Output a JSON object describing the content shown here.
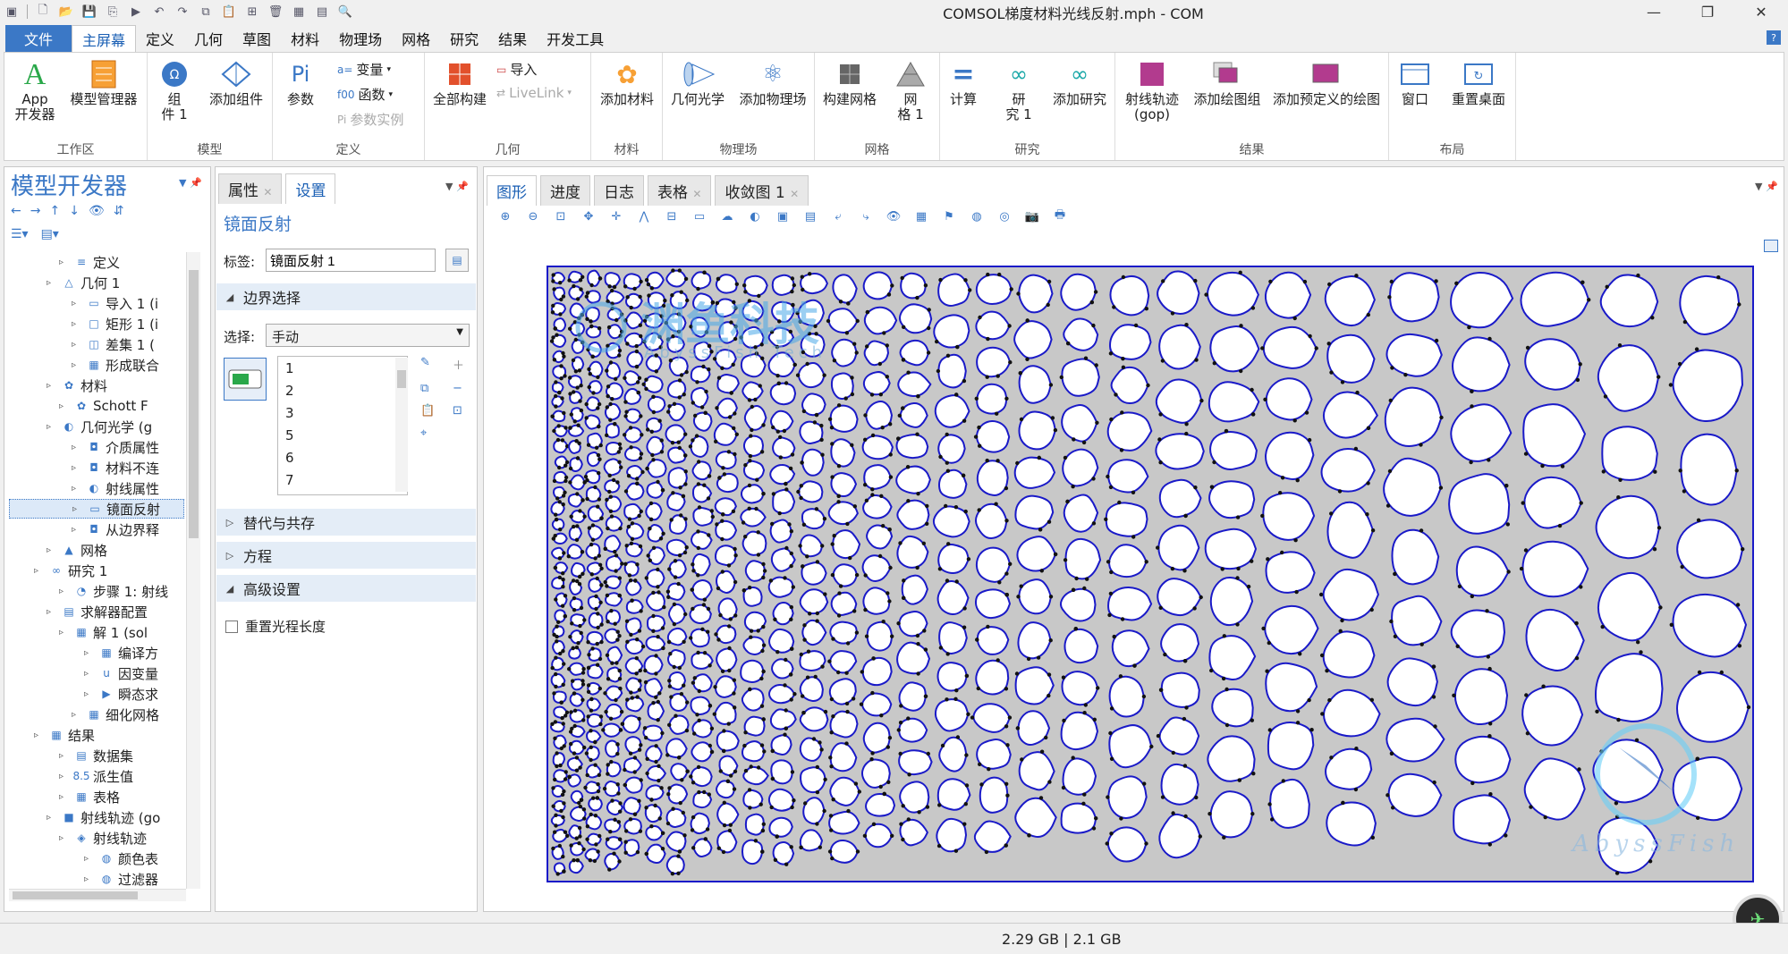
{
  "window": {
    "title": "COMSOL梯度材料光线反射.mph - COM"
  },
  "ribbon_tabs": [
    "文件",
    "主屏幕",
    "定义",
    "几何",
    "草图",
    "材料",
    "物理场",
    "网格",
    "研究",
    "结果",
    "开发工具"
  ],
  "ribbon": {
    "workspace": {
      "label": "工作区",
      "app_builder": "App\n开发器",
      "model_manager": "模型管理器"
    },
    "model": {
      "label": "模型",
      "component": "组\n件 1",
      "add_component": "添加组件"
    },
    "definitions": {
      "label": "定义",
      "parameters": "参数",
      "variables": "变量",
      "functions": "函数",
      "param_case": "参数实例"
    },
    "geometry": {
      "label": "几何",
      "build_all": "全部构建",
      "import": "导入",
      "livelink": "LiveLink"
    },
    "materials": {
      "label": "材料",
      "add_material": "添加材料"
    },
    "physics": {
      "label": "物理场",
      "geometric_optics": "几何光学",
      "add_physics": "添加物理场"
    },
    "mesh": {
      "label": "网格",
      "build_mesh": "构建网格",
      "mesh1": "网\n格 1"
    },
    "study": {
      "label": "研究",
      "compute": "计算",
      "study1": "研\n究 1",
      "add_study": "添加研究"
    },
    "results": {
      "label": "结果",
      "ray_trajectories": "射线轨迹\n(gop)",
      "add_plot_group": "添加绘图组",
      "add_predefined": "添加预定义的绘图"
    },
    "layout": {
      "label": "布局",
      "windows": "窗口",
      "reset_desktop": "重置桌面"
    }
  },
  "model_builder": {
    "title": "模型开发器",
    "tree": [
      {
        "label": "定义",
        "indent": 4,
        "icon": "≡"
      },
      {
        "label": "几何 1",
        "indent": 3,
        "icon": "△"
      },
      {
        "label": "导入 1 (i",
        "indent": 5,
        "icon": "▭"
      },
      {
        "label": "矩形 1 (i",
        "indent": 5,
        "icon": "□"
      },
      {
        "label": "差集 1 (",
        "indent": 5,
        "icon": "◫"
      },
      {
        "label": "形成联合",
        "indent": 5,
        "icon": "▦"
      },
      {
        "label": "材料",
        "indent": 3,
        "icon": "✿"
      },
      {
        "label": "Schott F",
        "indent": 4,
        "icon": "✿"
      },
      {
        "label": "几何光学 (g",
        "indent": 3,
        "icon": "◐"
      },
      {
        "label": "介质属性",
        "indent": 5,
        "icon": "◘"
      },
      {
        "label": "材料不连",
        "indent": 5,
        "icon": "◘"
      },
      {
        "label": "射线属性",
        "indent": 5,
        "icon": "◐"
      },
      {
        "label": "镜面反射",
        "indent": 5,
        "icon": "▭",
        "selected": true
      },
      {
        "label": "从边界释",
        "indent": 5,
        "icon": "◘"
      },
      {
        "label": "网格",
        "indent": 3,
        "icon": "▲"
      },
      {
        "label": "研究 1",
        "indent": 2,
        "icon": "∞"
      },
      {
        "label": "步骤 1: 射线",
        "indent": 4,
        "icon": "◔"
      },
      {
        "label": "求解器配置",
        "indent": 3,
        "icon": "▤"
      },
      {
        "label": "解 1 (sol",
        "indent": 4,
        "icon": "▦"
      },
      {
        "label": "编译方",
        "indent": 6,
        "icon": "▦"
      },
      {
        "label": "因变量",
        "indent": 6,
        "icon": "u"
      },
      {
        "label": "瞬态求",
        "indent": 6,
        "icon": "▶"
      },
      {
        "label": "细化网格",
        "indent": 5,
        "icon": "▦"
      },
      {
        "label": "结果",
        "indent": 2,
        "icon": "▦"
      },
      {
        "label": "数据集",
        "indent": 4,
        "icon": "▤"
      },
      {
        "label": "派生值",
        "indent": 4,
        "icon": "8.5"
      },
      {
        "label": "表格",
        "indent": 4,
        "icon": "▦"
      },
      {
        "label": "射线轨迹 (go",
        "indent": 3,
        "icon": "■"
      },
      {
        "label": "射线轨迹",
        "indent": 4,
        "icon": "◈"
      },
      {
        "label": "颜色表",
        "indent": 6,
        "icon": "◍"
      },
      {
        "label": "过滤器",
        "indent": 6,
        "icon": "◍"
      }
    ]
  },
  "settings": {
    "tabs": [
      "属性",
      "设置"
    ],
    "node_title": "镜面反射",
    "label_caption": "标签:",
    "label_value": "镜面反射 1",
    "boundary_selection": "边界选择",
    "selection_caption": "选择:",
    "selection_value": "手动",
    "boundaries": [
      "1",
      "2",
      "3",
      "5",
      "6",
      "7"
    ],
    "override": "替代与共存",
    "equation": "方程",
    "advanced": "高级设置",
    "reset_path": "重置光程长度"
  },
  "graphics": {
    "tabs": [
      "图形",
      "进度",
      "日志",
      "表格",
      "收敛图 1"
    ],
    "watermark_top": "渊鱼科技",
    "watermark_sub": "AbyssFish Tech",
    "watermark_bottom": "AbyssFish"
  },
  "status": {
    "memory": "2.29 GB | 2.1 GB"
  },
  "colors": {
    "accent": "#3b78c6",
    "boundary": "#1a1ac8",
    "domain": "#c8c8c8"
  }
}
